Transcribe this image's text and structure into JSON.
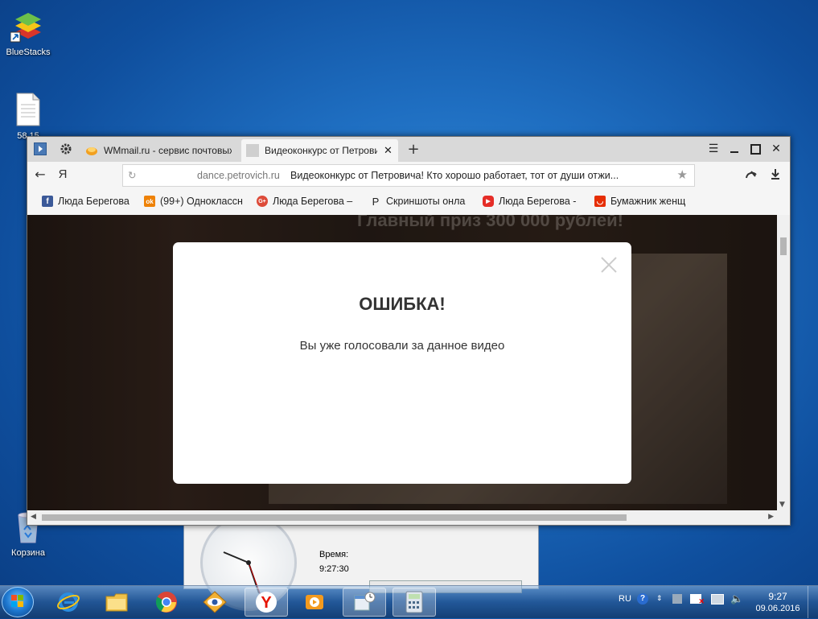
{
  "desktop": {
    "icons": [
      {
        "label": "BlueStacks"
      },
      {
        "label": "58.15"
      },
      {
        "label": "Корзина"
      }
    ]
  },
  "background_window": {
    "time_label": "Время:",
    "time_value": "9:27:30"
  },
  "browser": {
    "tabs": [
      {
        "title": "WMmail.ru - сервис почтовых"
      },
      {
        "title": "Видеоконкурс от Петрови"
      }
    ],
    "address": {
      "yandex_letter": "Я",
      "domain": "dance.petrovich.ru",
      "page_title": "Видеоконкурс от Петровича! Кто хорошо работает, тот от души отжи..."
    },
    "bookmarks": [
      {
        "label": "Люда Берегова",
        "icon": "facebook-icon",
        "color": "#3b5998",
        "glyph": "f"
      },
      {
        "label": "(99+) Одноклассн",
        "icon": "odnoklassniki-icon",
        "color": "#ee8208",
        "glyph": "ok"
      },
      {
        "label": "Люда Берегова –",
        "icon": "google-plus-icon",
        "color": "#dd4b39",
        "glyph": "G+"
      },
      {
        "label": "Скриншоты онла",
        "icon": "p-letter-icon",
        "color": "#ffffff",
        "glyph": "P"
      },
      {
        "label": "Люда Берегова -",
        "icon": "youtube-icon",
        "color": "#e52d27",
        "glyph": "▶"
      },
      {
        "label": "Бумажник женщ",
        "icon": "aliexpress-icon",
        "color": "#e62e04",
        "glyph": "◡"
      }
    ],
    "page": {
      "banner": "Главный приз 300 000 рублей!"
    },
    "modal": {
      "title": "ОШИБКА!",
      "message": "Вы уже голосовали за данное видео"
    }
  },
  "taskbar": {
    "language": "RU",
    "time": "9:27",
    "date": "09.06.2016"
  }
}
